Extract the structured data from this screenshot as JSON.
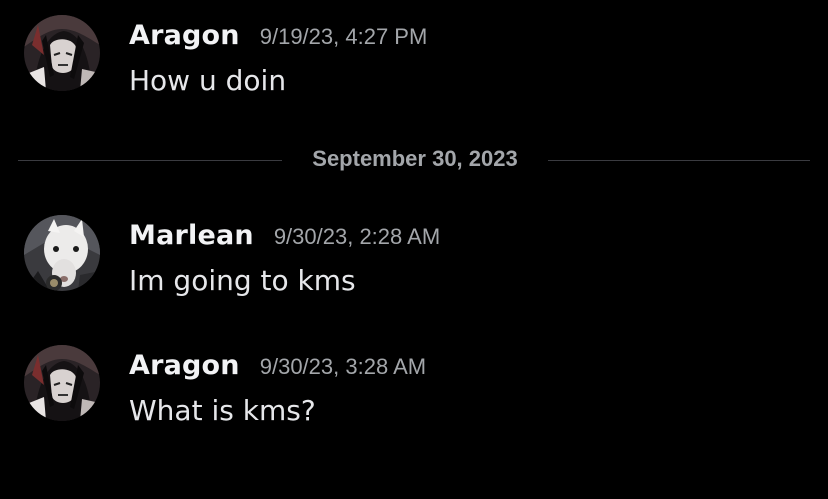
{
  "divider": {
    "date_label": "September 30, 2023"
  },
  "messages": [
    {
      "author": "Aragon",
      "timestamp": "9/19/23, 4:27 PM",
      "text": "How u doin",
      "avatar_icon": "dark-haired-character-avatar"
    },
    {
      "author": "Marlean",
      "timestamp": "9/30/23, 2:28 AM",
      "text": "Im going to kms",
      "avatar_icon": "white-animal-avatar"
    },
    {
      "author": "Aragon",
      "timestamp": "9/30/23, 3:28 AM",
      "text": "What is kms?",
      "avatar_icon": "dark-haired-character-avatar"
    }
  ],
  "colors": {
    "background": "#000000",
    "username": "#f2f3f5",
    "timestamp": "#a3a6aa",
    "message_text": "#e6e7ea",
    "divider_line": "#3a3b40"
  }
}
